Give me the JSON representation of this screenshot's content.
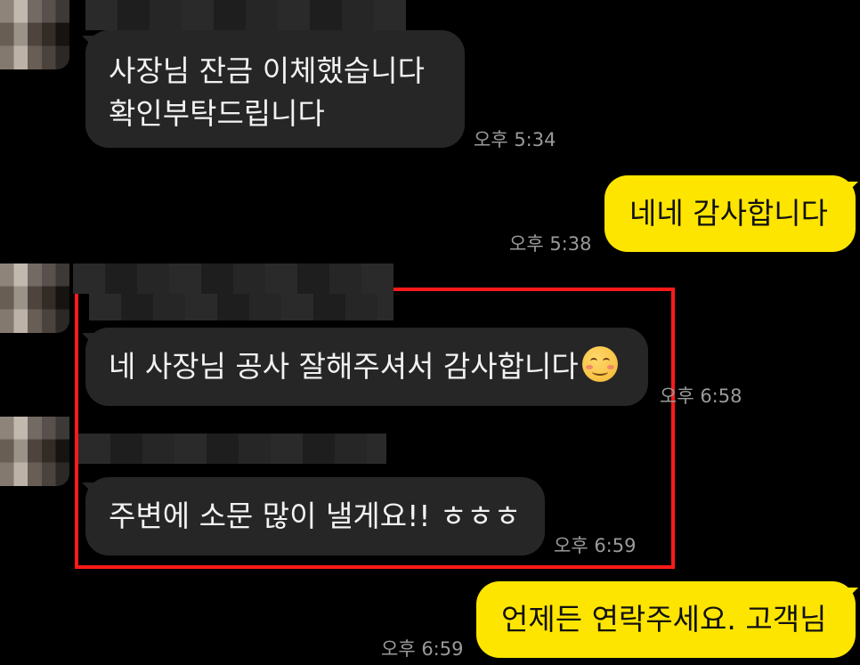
{
  "messages": [
    {
      "id": "m1",
      "sender": "other",
      "lines": [
        "사장님 잔금 이체했습니다",
        "확인부탁드립니다"
      ],
      "time": "오후 5:34"
    },
    {
      "id": "m2",
      "sender": "me",
      "lines": [
        "네네 감사합니다"
      ],
      "time": "오후 5:38"
    },
    {
      "id": "m3",
      "sender": "other",
      "lines": [
        "네 사장님 공사 잘해주셔서 감사합니다"
      ],
      "emoji": "smiling-face-emoji",
      "time": "오후 6:58"
    },
    {
      "id": "m4",
      "sender": "other",
      "lines": [
        "주변에 소문 많이 낼게요!! ㅎㅎㅎ"
      ],
      "time": "오후 6:59"
    },
    {
      "id": "m5",
      "sender": "me",
      "lines": [
        "언제든 연락주세요. 고객님"
      ],
      "time": "오후 6:59"
    }
  ],
  "colors": {
    "background": "#000000",
    "incoming_bubble": "#262626",
    "outgoing_bubble": "#fee500",
    "highlight_box": "#ff1a1a",
    "timestamp": "#9a9a9a"
  }
}
